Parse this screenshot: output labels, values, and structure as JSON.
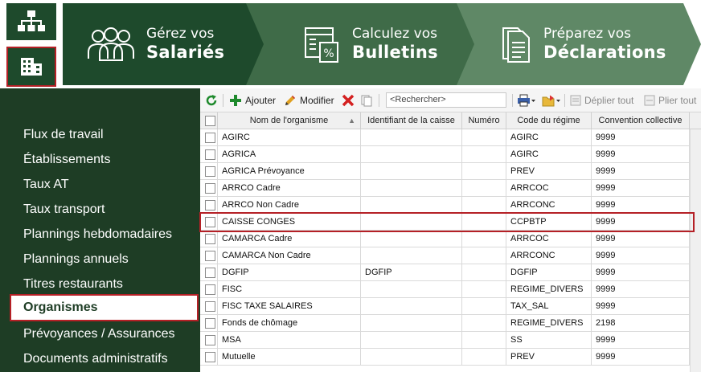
{
  "header": {
    "steps": [
      {
        "small": "Gérez vos",
        "big": "Salariés",
        "icon": "users-icon"
      },
      {
        "small": "Calculez vos",
        "big": "Bulletins",
        "icon": "calculator-icon"
      },
      {
        "small": "Préparez vos",
        "big": "Déclarations",
        "icon": "documents-icon"
      }
    ],
    "left_icons": [
      "org-chart-icon",
      "building-icon"
    ]
  },
  "sidebar": {
    "items": [
      "Flux de travail",
      "Établissements",
      "Taux AT",
      "Taux transport",
      "Plannings hebdomadaires",
      "Plannings annuels",
      "Titres restaurants",
      "Organismes",
      "Prévoyances / Assurances",
      "Documents administratifs"
    ],
    "active_index": 7
  },
  "toolbar": {
    "add_label": "Ajouter",
    "edit_label": "Modifier",
    "search_placeholder": "<Rechercher>",
    "expand_label": "Déplier tout",
    "collapse_label": "Plier tout"
  },
  "grid": {
    "columns": [
      "Nom de l'organisme",
      "Identifiant de la caisse",
      "Numéro",
      "Code du régime",
      "Convention collective"
    ],
    "rows": [
      [
        "AGIRC",
        "",
        "",
        "AGIRC",
        "9999"
      ],
      [
        "AGRICA",
        "",
        "",
        "AGIRC",
        "9999"
      ],
      [
        "AGRICA Prévoyance",
        "",
        "",
        "PREV",
        "9999"
      ],
      [
        "ARRCO Cadre",
        "",
        "",
        "ARRCOC",
        "9999"
      ],
      [
        "ARRCO Non Cadre",
        "",
        "",
        "ARRCONC",
        "9999"
      ],
      [
        "CAISSE CONGES",
        "",
        "",
        "CCPBTP",
        "9999"
      ],
      [
        "CAMARCA Cadre",
        "",
        "",
        "ARRCOC",
        "9999"
      ],
      [
        "CAMARCA Non Cadre",
        "",
        "",
        "ARRCONC",
        "9999"
      ],
      [
        "DGFIP",
        "DGFIP",
        "",
        "DGFIP",
        "9999"
      ],
      [
        "FISC",
        "",
        "",
        "REGIME_DIVERS",
        "9999"
      ],
      [
        "FISC TAXE SALAIRES",
        "",
        "",
        "TAX_SAL",
        "9999"
      ],
      [
        "Fonds de chômage",
        "",
        "",
        "REGIME_DIVERS",
        "2198"
      ],
      [
        "MSA",
        "",
        "",
        "SS",
        "9999"
      ],
      [
        "Mutuelle",
        "",
        "",
        "PREV",
        "9999"
      ]
    ],
    "selected_index": 5
  },
  "colors": {
    "dark_green": "#1e3d25",
    "step1": "#1e4a2c",
    "step2": "#3f6b48",
    "step3": "#5f8866",
    "highlight_red": "#b52026"
  }
}
